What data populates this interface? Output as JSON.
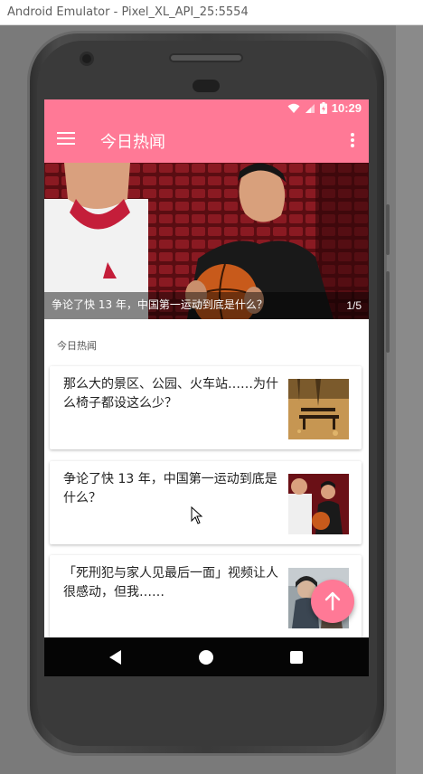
{
  "window": {
    "title": "Android Emulator - Pixel_XL_API_25:5554"
  },
  "status_bar": {
    "time": "10:29"
  },
  "app_bar": {
    "title": "今日热闻"
  },
  "banner": {
    "caption": "争论了快 13 年，中国第一运动到底是什么？",
    "index": "1/5"
  },
  "section_header": "今日热闻",
  "stories": [
    {
      "title": "那么大的景区、公园、火车站……为什么椅子都设这么少？",
      "thumb": "park-bench-photo"
    },
    {
      "title": "争论了快 13 年，中国第一运动到底是什么？",
      "thumb": "basketball-players-photo"
    },
    {
      "title": "「死刑犯与家人见最后一面」视频让人很感动，但我……",
      "thumb": "people-photo"
    }
  ],
  "colors": {
    "accent": "#ff7996",
    "navbar": "#050505",
    "titlebar": "#ffffff"
  },
  "icons": {
    "menu": "hamburger-menu-icon",
    "more": "overflow-menu-icon",
    "fab": "arrow-up-icon",
    "nav_back": "back-triangle-icon",
    "nav_home": "home-circle-icon",
    "nav_recent": "recent-apps-square-icon"
  }
}
